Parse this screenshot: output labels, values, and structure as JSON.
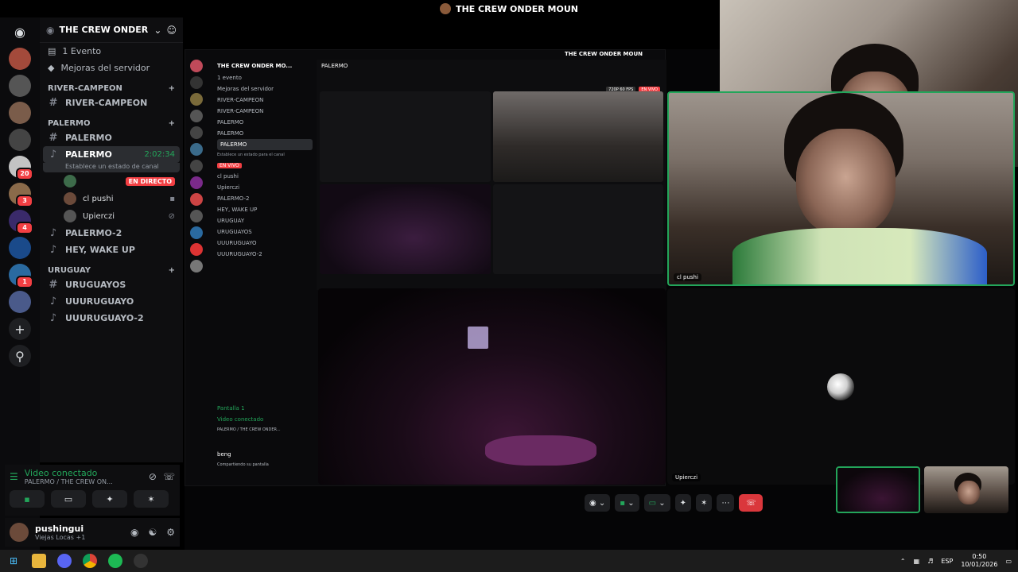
{
  "window": {
    "title": "THE CREW ONDER MOUN"
  },
  "server": {
    "name": "THE CREW ONDER ...",
    "events": "1 Evento",
    "boost": "Mejoras del servidor"
  },
  "rail_badges": {
    "b1": "20",
    "b2": "3",
    "b3": "4",
    "b4": "1"
  },
  "categories": [
    {
      "name": "RIVER-CAMPEON",
      "channels": [
        "RIVER-CAMPEON"
      ]
    },
    {
      "name": "PALERMO",
      "channels": [
        "PALERMO"
      ]
    },
    {
      "name": "URUGUAY",
      "channels": [
        "URUGUAYOS",
        "UUURUGUAYO",
        "UUURUGUAYO-2"
      ]
    }
  ],
  "active_channel": {
    "name": "PALERMO",
    "timer": "2:02:34",
    "status": "Establece un estado de canal"
  },
  "members": [
    {
      "name": "",
      "live": "EN DIRECTO"
    },
    {
      "name": "cl pushi"
    },
    {
      "name": "Upierczi"
    }
  ],
  "other_voice": [
    "PALERMO-2",
    "HEY, WAKE UP"
  ],
  "voice_panel": {
    "status": "Video conectado",
    "location": "PALERMO / THE CREW ON..."
  },
  "user": {
    "name": "pushingui",
    "status": "Viejas Locas +1"
  },
  "stage": {
    "share_title": "PALERMO",
    "share_header": "THE CREW ONDER MOUN",
    "cam_name": "cl pushi",
    "dark_name": "Upierczi"
  },
  "inner": {
    "server": "THE CREW ONDER MO...",
    "events": "1 evento",
    "boost": "Mejoras del servidor",
    "ch1": "RIVER-CAMPEON",
    "ch2": "RIVER-CAMPEON",
    "cat2": "PALERMO",
    "ch3": "PALERMO",
    "ch4": "PALERMO",
    "ch4_status": "Establece un estado para el canal",
    "live": "EN VIVO",
    "m1": "cl pushi",
    "m2": "Upierczi",
    "ch5": "PALERMO-2",
    "ch6": "HEY, WAKE UP",
    "cat3": "URUGUAY",
    "ch7": "URUGUAYOS",
    "ch8": "UUURUGUAYO",
    "ch9": "UUURUGUAYO-2",
    "screen": "Pantalla 1",
    "video": "Video conectado",
    "video_where": "PALERMO / THE CREW ONDER...",
    "user": "beng",
    "user_status": "Compartiendo su pantalla",
    "quality": "720P 60 FPS",
    "live2": "EN VIVO"
  },
  "taskbar": {
    "lang": "ESP",
    "time": "0:50",
    "date": "10/01/2026"
  },
  "colors": {
    "accent": "#23a55a",
    "live": "#f23f43",
    "hangup": "#da373c"
  }
}
